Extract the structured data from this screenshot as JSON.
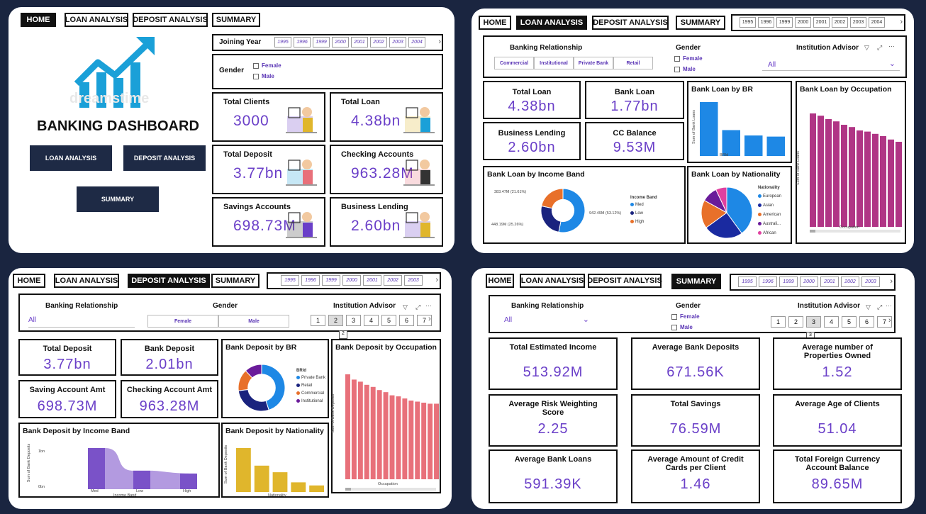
{
  "colors": {
    "accent": "#6a3fc8",
    "nav": "#1e2a45",
    "teal": "#1aa0d8",
    "loanBars": "#b03585",
    "depBars": "#e8707a",
    "incomeBars": "#7a52c8",
    "natBars": "#e0b62c",
    "blue": "#1e88e5"
  },
  "p1": {
    "tabs": [
      "HOME",
      "LOAN ANALYSIS",
      "DEPOSIT ANALYSIS",
      "SUMMARY"
    ],
    "logo_text": "dreamstime",
    "title": "BANKING DASHBOARD",
    "buttons": {
      "loan": "LOAN ANALYSIS",
      "deposit": "DEPOSIT ANALYSIS",
      "summary": "SUMMARY"
    },
    "joining_year_label": "Joining Year",
    "years": [
      "1995",
      "1996",
      "1999",
      "2000",
      "2001",
      "2002",
      "2003",
      "2004"
    ],
    "gender_label": "Gender",
    "gender_options": [
      "Female",
      "Male"
    ],
    "cards": [
      {
        "title": "Total Clients",
        "value": "3000",
        "icon": "desk-icon"
      },
      {
        "title": "Total Loan",
        "value": "4.38bn",
        "icon": "loan-icon"
      },
      {
        "title": "Total Deposit",
        "value": "3.77bn",
        "icon": "deposit-icon"
      },
      {
        "title": "Checking Accounts",
        "value": "963.28M",
        "icon": "laptop-icon"
      },
      {
        "title": "Savings Accounts",
        "value": "698.73M",
        "icon": "savings-icon"
      },
      {
        "title": "Business Lending",
        "value": "2.60bn",
        "icon": "growth-icon"
      }
    ]
  },
  "p2": {
    "tabs": [
      "HOME",
      "LOAN ANALYSIS",
      "DEPOSIT ANALYSIS",
      "SUMMARY"
    ],
    "years": [
      "1995",
      "1996",
      "1999",
      "2000",
      "2001",
      "2002",
      "2003",
      "2004"
    ],
    "br_label": "Banking Relationship",
    "br_options": [
      "Commercial",
      "Institutional",
      "Private Bank",
      "Retail"
    ],
    "gender_label": "Gender",
    "gender_options": [
      "Female",
      "Male"
    ],
    "advisor_label": "Institution Advisor",
    "advisor_value": "All",
    "cards": [
      {
        "title": "Total Loan",
        "value": "4.38bn"
      },
      {
        "title": "Bank Loan",
        "value": "1.77bn"
      },
      {
        "title": "Business Lending",
        "value": "2.60bn"
      },
      {
        "title": "CC Balance",
        "value": "9.53M"
      }
    ],
    "br_chart": {
      "title": "Bank Loan by BR",
      "ylabel": "Sum of Bank Loans",
      "xlabel": "BRId"
    },
    "occ_chart": {
      "title": "Bank Loan by Occupation",
      "ylabel": "Sum of Bank Loans",
      "xlabel": "Occupation"
    },
    "income_chart": {
      "title": "Bank Loan by Income Band",
      "legend_title": "Income Band",
      "legend": [
        "Med",
        "Low",
        "High"
      ],
      "labels": [
        "942.49M (53.12%)",
        "448.19M (25.26%)",
        "383.47M (21.61%)"
      ]
    },
    "nat_chart": {
      "title": "Bank Loan by Nationality",
      "legend_title": "Nationality",
      "legend": [
        "European",
        "Asian",
        "American",
        "Australi...",
        "African"
      ]
    }
  },
  "p3": {
    "tabs": [
      "HOME",
      "LOAN ANALYSIS",
      "DEPOSIT ANALYSIS",
      "SUMMARY"
    ],
    "years": [
      "1995",
      "1996",
      "1999",
      "2000",
      "2001",
      "2002",
      "2003"
    ],
    "br_label": "Banking Relationship",
    "br_value": "All",
    "gender_label": "Gender",
    "gender_options": [
      "Female",
      "Male"
    ],
    "advisor_label": "Institution Advisor",
    "pages": [
      "1",
      "2",
      "3",
      "4",
      "5",
      "6",
      "7"
    ],
    "page_tip": "2",
    "cards": [
      {
        "title": "Total Deposit",
        "value": "3.77bn"
      },
      {
        "title": "Bank Deposit",
        "value": "2.01bn"
      },
      {
        "title": "Saving Account Amt",
        "value": "698.73M"
      },
      {
        "title": "Checking Account Amt",
        "value": "963.28M"
      }
    ],
    "br_chart": {
      "title": "Bank Deposit by BR",
      "legend_title": "BRId",
      "legend": [
        "Private Bank",
        "Retail",
        "Commercial",
        "Institutional"
      ]
    },
    "occ_chart": {
      "title": "Bank Deposit by Occupation",
      "ylabel": "Sum of Bank Deposits",
      "xlabel": "Occupation"
    },
    "income_chart": {
      "title": "Bank Deposit by Income Band",
      "ylabel": "Sum of Bank Deposits",
      "xlabel": "Income Band",
      "yticks": [
        "1bn",
        "0bn"
      ],
      "categories": [
        "Med",
        "Low",
        "High"
      ]
    },
    "nat_chart": {
      "title": "Bank Deposit by Nationality",
      "ylabel": "Sum of Bank Deposits",
      "xlabel": "Nationality"
    }
  },
  "p4": {
    "tabs": [
      "HOME",
      "LOAN ANALYSIS",
      "DEPOSIT ANALYSIS",
      "SUMMARY"
    ],
    "years": [
      "1995",
      "1996",
      "1999",
      "2000",
      "2001",
      "2002",
      "2003"
    ],
    "br_label": "Banking Relationship",
    "br_value": "All",
    "gender_label": "Gender",
    "gender_options": [
      "Female",
      "Male"
    ],
    "advisor_label": "Institution Advisor",
    "pages": [
      "1",
      "2",
      "3",
      "4",
      "5",
      "6",
      "7"
    ],
    "page_tip": "3",
    "cards": [
      {
        "title": "Total Estimated Income",
        "value": "513.92M"
      },
      {
        "title": "Average Bank Deposits",
        "value": "671.56K"
      },
      {
        "title": "Average number of Properties Owned",
        "value": "1.52"
      },
      {
        "title": "Average Risk Weighting Score",
        "value": "2.25"
      },
      {
        "title": "Total Savings",
        "value": "76.59M"
      },
      {
        "title": "Average Age of Clients",
        "value": "51.04"
      },
      {
        "title": "Average Bank Loans",
        "value": "591.39K"
      },
      {
        "title": "Average Amount of Credit Cards per Client",
        "value": "1.46"
      },
      {
        "title": "Total Foreign Currency Account Balance",
        "value": "89.65M"
      }
    ]
  },
  "chart_data": [
    {
      "type": "bar",
      "title": "Bank Loan by BR",
      "categories": [
        "1",
        "2",
        "3",
        "4"
      ],
      "values": [
        1.0,
        0.48,
        0.38,
        0.36
      ],
      "xlabel": "BRId",
      "ylabel": "Sum of Bank Loans"
    },
    {
      "type": "bar",
      "title": "Bank Loan by Occupation",
      "values": [
        1.0,
        0.98,
        0.95,
        0.93,
        0.9,
        0.88,
        0.85,
        0.84,
        0.82,
        0.8,
        0.77,
        0.75
      ],
      "xlabel": "Occupation",
      "ylabel": "Sum of Bank Loans"
    },
    {
      "type": "pie",
      "title": "Bank Loan by Income Band",
      "categories": [
        "Med",
        "Low",
        "High"
      ],
      "values": [
        53.12,
        25.26,
        21.61
      ]
    },
    {
      "type": "pie",
      "title": "Bank Loan by Nationality",
      "categories": [
        "European",
        "Asian",
        "American",
        "Australi...",
        "African"
      ],
      "values": [
        40,
        25,
        18,
        10,
        7
      ]
    },
    {
      "type": "pie",
      "title": "Bank Deposit by BR",
      "categories": [
        "Private Bank",
        "Retail",
        "Commercial",
        "Institutional"
      ],
      "values": [
        45,
        28,
        15,
        12
      ]
    },
    {
      "type": "bar",
      "title": "Bank Deposit by Occupation",
      "values": [
        1.0,
        0.95,
        0.93,
        0.9,
        0.88,
        0.85,
        0.83,
        0.8,
        0.79,
        0.77,
        0.75,
        0.74,
        0.73,
        0.72,
        0.72
      ],
      "xlabel": "Occupation",
      "ylabel": "Sum of Bank Deposits"
    },
    {
      "type": "area",
      "title": "Bank Deposit by Income Band",
      "categories": [
        "Med",
        "Low",
        "High"
      ],
      "values": [
        1.0,
        0.45,
        0.38
      ],
      "xlabel": "Income Band",
      "ylabel": "Sum of Bank Deposits"
    },
    {
      "type": "bar",
      "title": "Bank Deposit by Nationality",
      "values": [
        1.0,
        0.6,
        0.45,
        0.22,
        0.15
      ],
      "xlabel": "Nationality",
      "ylabel": "Sum of Bank Deposits"
    }
  ]
}
